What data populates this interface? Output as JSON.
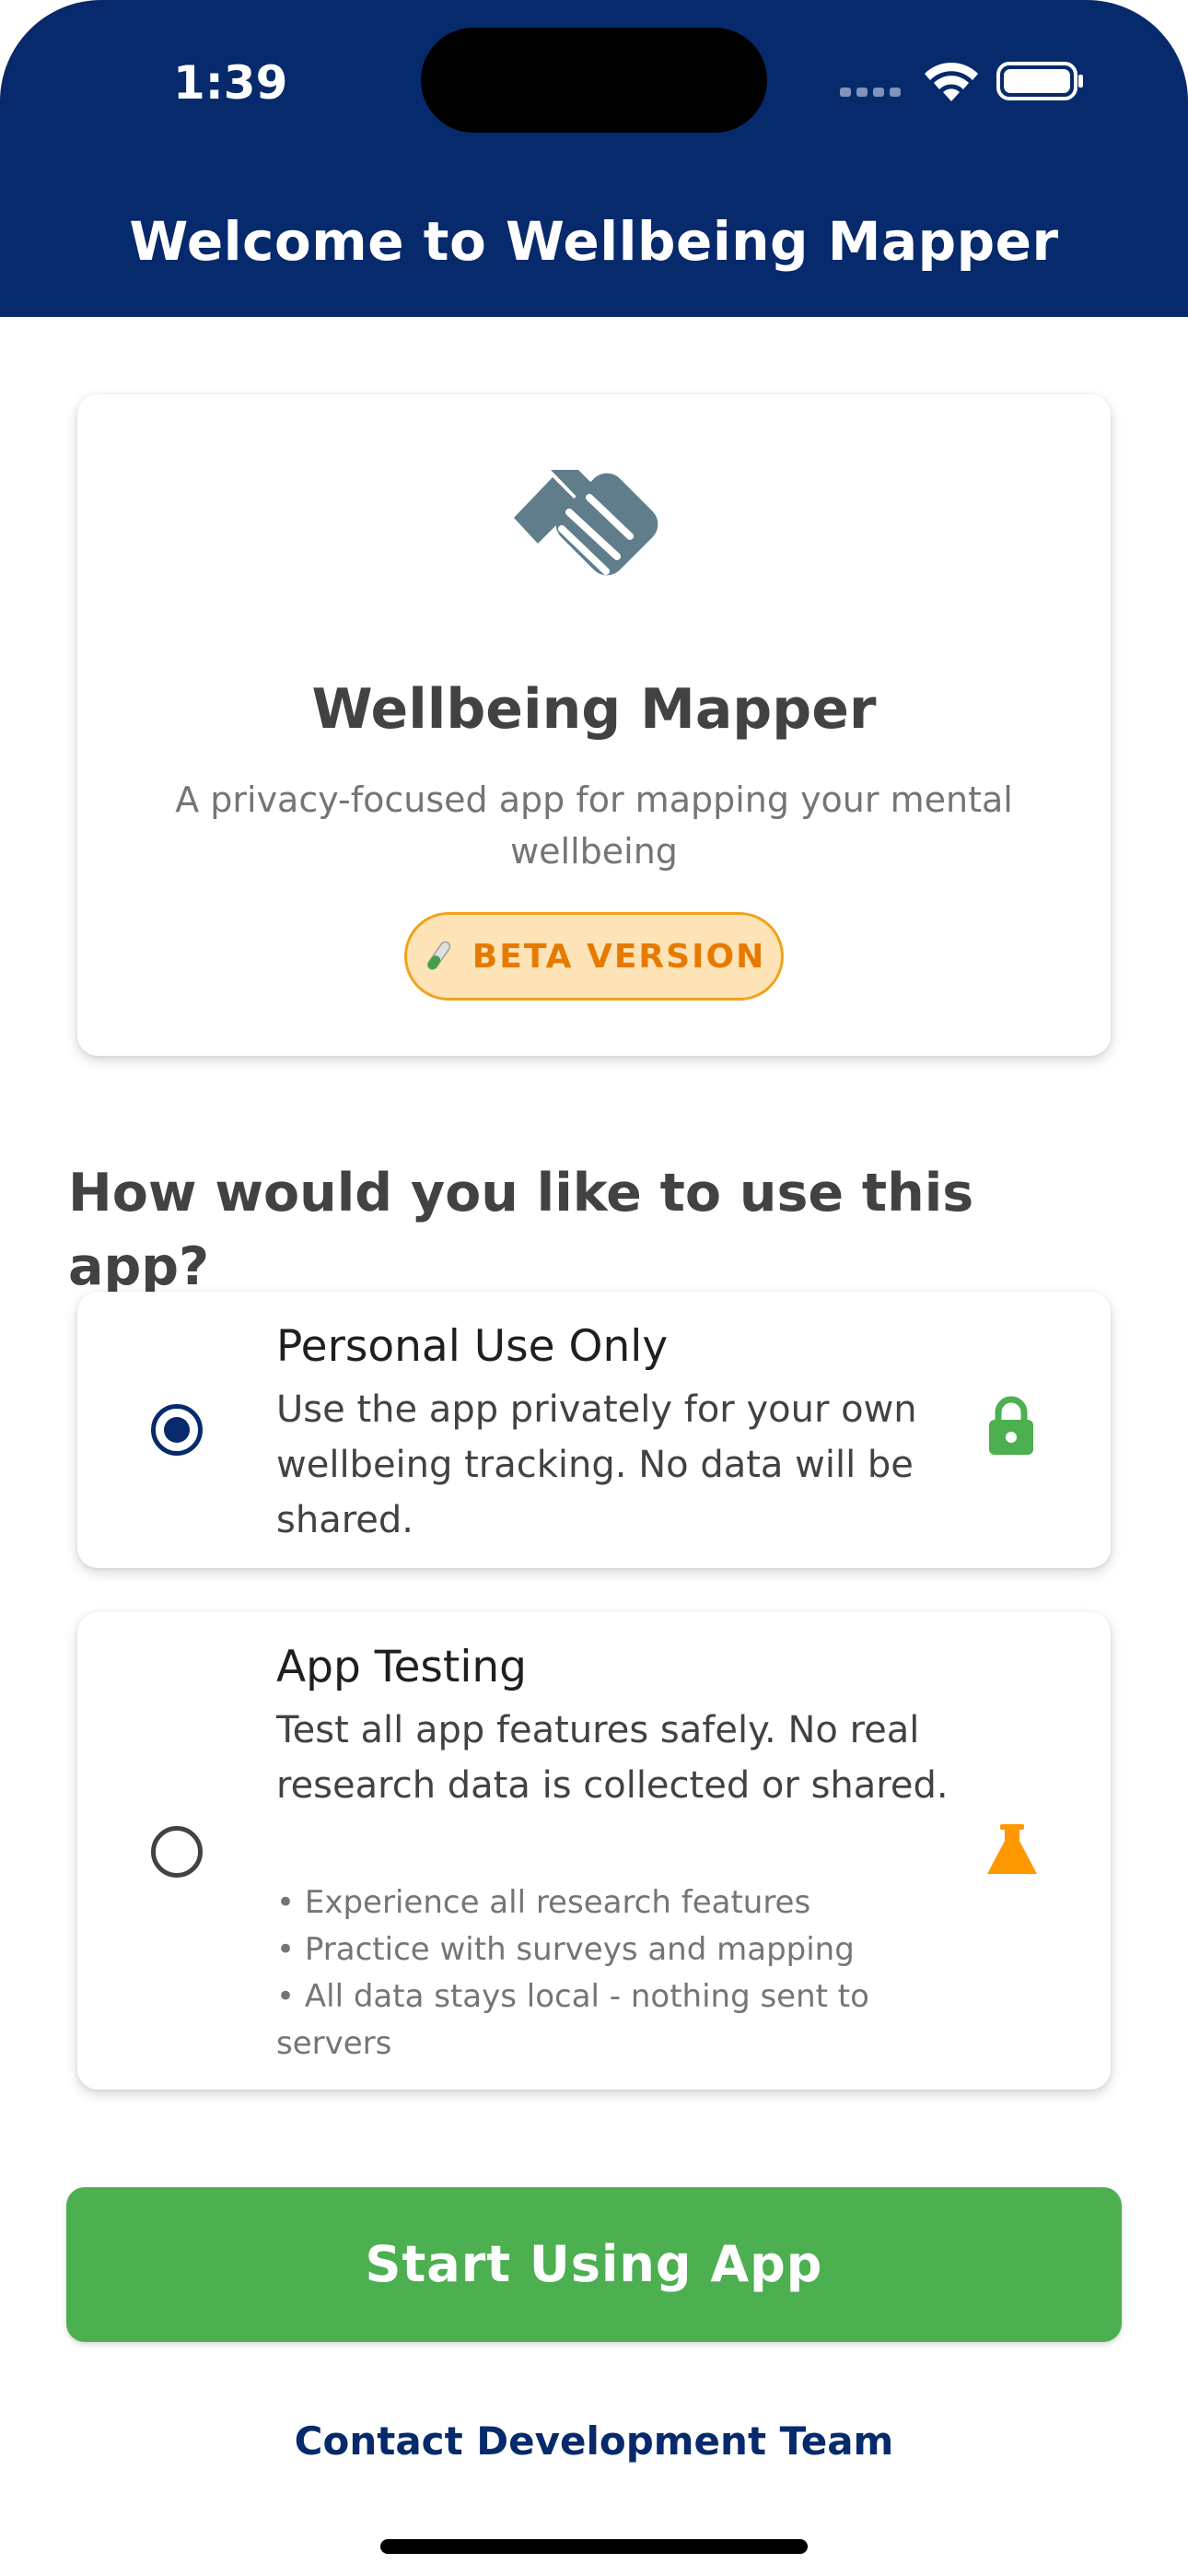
{
  "status_bar": {
    "time": "1:39",
    "icons": [
      "signal-icon",
      "wifi-icon",
      "battery-icon"
    ]
  },
  "header": {
    "title": "Welcome to Wellbeing Mapper",
    "background": "#062a6b"
  },
  "hero": {
    "logo_icon": "handshake-icon",
    "logo_color": "#607d8b",
    "app_name": "Wellbeing Mapper",
    "description": "A privacy-focused app for mapping your mental wellbeing",
    "badge": {
      "icon": "test-tube-icon",
      "label": "BETA VERSION",
      "text_color": "#e67a00",
      "fill_color": "#fde3b5"
    }
  },
  "question": "How would you like to use this app?",
  "options": [
    {
      "title": "Personal Use Only",
      "description": "Use the app privately for your own wellbeing tracking. No data will be shared.",
      "selected": true,
      "icon": "lock-icon",
      "icon_color": "#4caf50",
      "bullets": []
    },
    {
      "title": "App Testing",
      "description": "Test all app features safely. No real research data is collected or shared.",
      "selected": false,
      "icon": "flask-icon",
      "icon_color": "#ff9800",
      "bullets": [
        "Experience all research features",
        "Practice with surveys and mapping",
        "All data stays local - nothing sent to servers"
      ]
    }
  ],
  "start_button": {
    "label": "Start Using App",
    "color": "#4caf50"
  },
  "contact_link": "Contact Development Team"
}
